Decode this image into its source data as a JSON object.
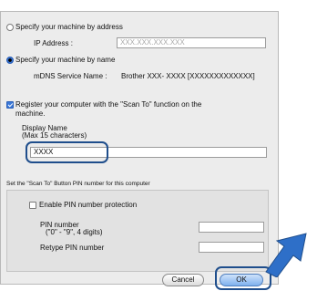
{
  "address_option": {
    "label": "Specify your machine by address",
    "ip_label": "IP Address :",
    "ip_placeholder": "XXX.XXX.XXX.XXX"
  },
  "name_option": {
    "label": "Specify your machine by name",
    "service_label": "mDNS Service Name :",
    "service_value": "Brother  XXX- XXXX   [XXXXXXXXXXXXX]"
  },
  "register": {
    "label_line1": "Register your computer with the \"Scan To\" function on the",
    "label_line2": "machine.",
    "display_name_label": "Display Name",
    "display_name_hint": "(Max 15 characters)",
    "display_name_value": "XXXX"
  },
  "pin_section": {
    "title": "Set the \"Scan To\" Button PIN number for this computer",
    "enable_label": "Enable PIN number protection",
    "pin_label_line1": "PIN number",
    "pin_label_line2": "(\"0\" - \"9\",  4 digits)",
    "retype_label": "Retype PIN number"
  },
  "buttons": {
    "cancel": "Cancel",
    "ok": "OK"
  },
  "colors": {
    "highlight": "#1f4e8c",
    "arrow": "#2e6fc8"
  },
  "state": {
    "address_selected": false,
    "name_selected": true,
    "register_checked": true,
    "pin_enabled": false
  }
}
